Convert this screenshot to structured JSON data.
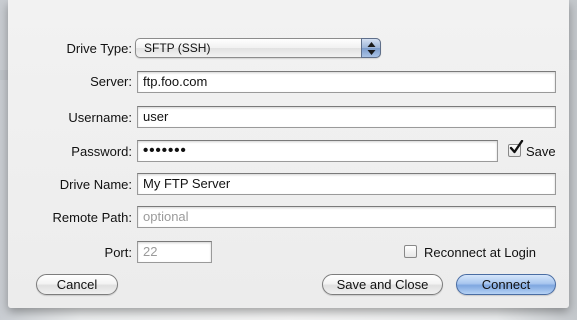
{
  "form": {
    "drive_type": {
      "label": "Drive Type:",
      "value": "SFTP (SSH)"
    },
    "server": {
      "label": "Server:",
      "value": "ftp.foo.com"
    },
    "username": {
      "label": "Username:",
      "value": "user"
    },
    "password": {
      "label": "Password:",
      "value": "•••••••"
    },
    "save_checkbox": {
      "label": "Save",
      "checked": true
    },
    "drive_name": {
      "label": "Drive Name:",
      "value": "My FTP Server"
    },
    "remote_path": {
      "label": "Remote Path:",
      "value": "",
      "placeholder": "optional"
    },
    "port": {
      "label": "Port:",
      "value": "",
      "placeholder": "22"
    },
    "reconnect_checkbox": {
      "label": "Reconnect at Login",
      "checked": false
    }
  },
  "buttons": {
    "cancel": "Cancel",
    "save_and_close": "Save and Close",
    "connect": "Connect"
  },
  "icons": {
    "popup_arrows": "up-down-arrows-icon",
    "checkmark": "checkmark-icon"
  },
  "colors": {
    "accent": "#7fa7e0",
    "sheet": "#ececec",
    "placeholder_text": "#9b9b9b"
  }
}
